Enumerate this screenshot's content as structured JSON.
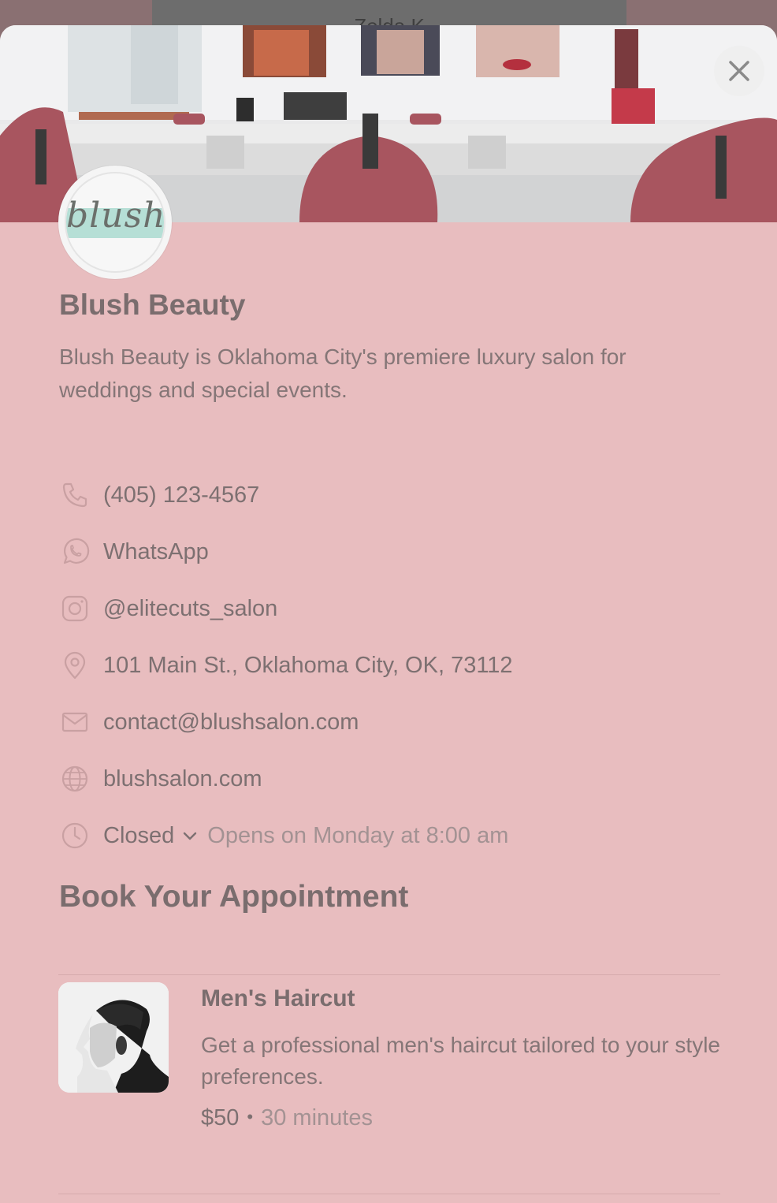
{
  "backdrop": {
    "name": "Zelda K"
  },
  "close_label": "×",
  "logo": {
    "text": "blush."
  },
  "business": {
    "name": "Blush Beauty",
    "description": "Blush Beauty is Oklahoma City's premiere luxury salon for weddings and special events."
  },
  "contact": {
    "phone": "(405) 123-4567",
    "whatsapp": "WhatsApp",
    "instagram": "@elitecuts_salon",
    "address": "101 Main St., Oklahoma City, OK, 73112",
    "email": "contact@blushsalon.com",
    "website": "blushsalon.com"
  },
  "hours": {
    "status": "Closed",
    "next_open": "Opens on Monday at 8:00 am"
  },
  "booking": {
    "title": "Book Your Appointment",
    "services": [
      {
        "name": "Men's Haircut",
        "description": "Get a professional men's haircut tailored to your style preferences.",
        "price": "$50",
        "separator": "•",
        "duration": "30 minutes"
      }
    ]
  },
  "icons": [
    "phone-icon",
    "whatsapp-icon",
    "instagram-icon",
    "location-pin-icon",
    "mail-icon",
    "globe-icon",
    "clock-icon",
    "chevron-down-icon",
    "close-icon"
  ],
  "colors": {
    "sheet": "#e8bdbf",
    "chair": "#a8555f",
    "text": "#7a6d6e",
    "muted": "#a39293"
  }
}
